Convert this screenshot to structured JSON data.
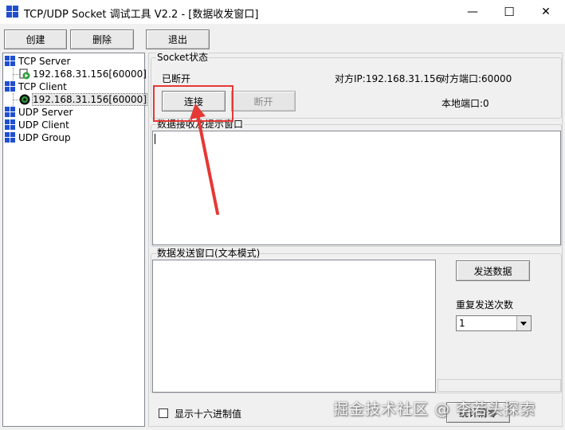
{
  "window": {
    "title": "TCP/UDP Socket 调试工具 V2.2 - [数据收发窗口]",
    "minimize_glyph": "—",
    "maximize_glyph": "☐",
    "close_glyph": "✕"
  },
  "toolbar": {
    "create_label": "创建",
    "delete_label": "删除",
    "exit_label": "退出"
  },
  "tree": {
    "items": [
      {
        "label": "TCP Server",
        "icon": "tcp-server-icon"
      },
      {
        "label": "192.168.31.156[60000]",
        "icon": "server-connection-icon"
      },
      {
        "label": "TCP Client",
        "icon": "tcp-client-icon"
      },
      {
        "label": "192.168.31.156[60000]",
        "icon": "client-connection-icon"
      },
      {
        "label": "UDP Server",
        "icon": "udp-server-icon"
      },
      {
        "label": "UDP Client",
        "icon": "udp-client-icon"
      },
      {
        "label": "UDP Group",
        "icon": "udp-group-icon"
      }
    ]
  },
  "socket_status": {
    "group_label": "Socket状态",
    "state": "已断开",
    "remote_ip": "对方IP:192.168.31.156",
    "remote_port": "对方端口:60000",
    "local_port": "本地端口:0",
    "connect_label": "连接",
    "disconnect_label": "断开"
  },
  "receive": {
    "group_label": "数据接收及提示窗口"
  },
  "send": {
    "group_label": "数据发送窗口(文本模式)",
    "send_label": "发送数据",
    "repeat_label": "重复发送次数",
    "repeat_value": "1",
    "stats_clear_label": "统计清零"
  },
  "options": {
    "hex_label": "显示十六进制值"
  },
  "overlay": {
    "watermark": "掘金技术社区 @ 李若头探索"
  },
  "colors": {
    "highlight": "#e53935",
    "icon_blue": "#1f4fd1",
    "icon_green": "#2e9b3a"
  }
}
